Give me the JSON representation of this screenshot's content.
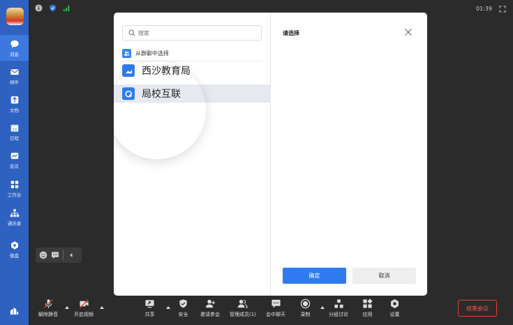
{
  "status": {
    "time": "01:39"
  },
  "sidebar": {
    "items": [
      {
        "label": "消息",
        "icon": "chat-bubble-icon",
        "active": true
      },
      {
        "label": "邮件",
        "icon": "mail-icon"
      },
      {
        "label": "文档",
        "icon": "document-icon"
      },
      {
        "label": "日程",
        "icon": "calendar-icon"
      },
      {
        "label": "会议",
        "icon": "meeting-icon"
      },
      {
        "label": "工作台",
        "icon": "grid-icon"
      },
      {
        "label": "通讯录",
        "icon": "org-chart-icon"
      },
      {
        "label": "微盘",
        "icon": "drive-icon"
      }
    ]
  },
  "dialog": {
    "search_placeholder": "搜索",
    "from_group_label": "从群聊中选择",
    "list": [
      {
        "name": "西沙教育局"
      },
      {
        "name": "局校互联",
        "selected": true
      }
    ],
    "title": "请选择",
    "ok_label": "确定",
    "cancel_label": "取消"
  },
  "toolbar": {
    "mute": "解除静音",
    "video": "开启视频",
    "share": "共享",
    "security": "安全",
    "invite": "邀请参会",
    "members": "管理成员(1)",
    "chat": "会中聊天",
    "record": "录制",
    "breakout": "分组讨论",
    "apps": "应用",
    "settings": "设置",
    "end": "结束会议"
  },
  "colors": {
    "sidebar": "#2f62c0",
    "accent": "#2f7cf0",
    "end_red": "#e0413b",
    "background": "#2b2b2b"
  }
}
